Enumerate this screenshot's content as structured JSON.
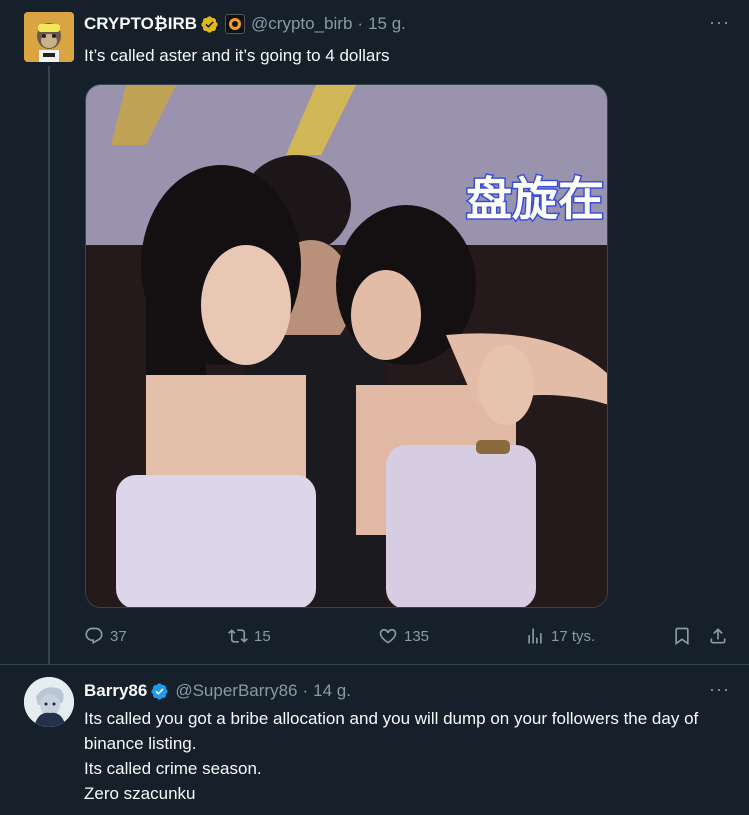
{
  "tweet1": {
    "name": "CRYPTO₿IRB",
    "handle": "@crypto_birb",
    "separator": "·",
    "time": "15 g.",
    "text": "It’s called aster and it’s going to 4 dollars",
    "more_icon": "more-dots-icon",
    "actions": {
      "reply_count": "37",
      "retweet_count": "15",
      "like_count": "135",
      "views_count": "17 tys."
    }
  },
  "tweet2": {
    "name": "Barry86",
    "handle": "@SuperBarry86",
    "separator": "·",
    "time": "14 g.",
    "text_lines": [
      "Its called you got a bribe allocation and you will dump on your followers the day of binance listing.",
      "Its called crime season.",
      "Zero szacunku"
    ],
    "more_icon": "more-dots-icon"
  },
  "media": {
    "overlay_text": "盘旋在"
  },
  "colors": {
    "background": "#15202b",
    "text_primary": "#f7f9f9",
    "text_secondary": "#8b98a5",
    "verified_gold": "#e2b719",
    "verified_blue": "#1d9bf0",
    "divider": "#38444d"
  }
}
